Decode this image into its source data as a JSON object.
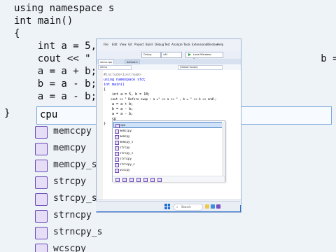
{
  "background_editor": {
    "code_lines": [
      "using namespace s",
      "int main()",
      "{",
      "    int a = 5, b",
      "    cout << \" Be                                    b = \" << b << endl;",
      "    a = a + b;",
      "    b = a - b;",
      "    a = a - b;",
      "    cp"
    ],
    "typed_text": "cpu",
    "suggestions": [
      "memccpy",
      "memcpy",
      "memcpy_s",
      "strcpy",
      "strcpy_s",
      "strncpy",
      "strncpy_s",
      "wcscpy"
    ],
    "highlight": "cpy",
    "closing_brace": "}"
  },
  "vs": {
    "menu": [
      "File",
      "Edit",
      "View",
      "Git",
      "Project",
      "Build",
      "Debug",
      "Test",
      "Analyze",
      "Tools",
      "Extensions",
      "Window",
      "Help"
    ],
    "config": "Debug",
    "platform": "x64",
    "run_label": "Local Windows Debugger",
    "tabs": [
      "demo.cpp",
      "default.h"
    ],
    "nav_scope": "demo",
    "nav_global": "(Global Scope)",
    "code": [
      {
        "text": "#include<iostream>",
        "kind": "pp"
      },
      {
        "text": "using namespace std;",
        "kind": "kw"
      },
      {
        "text": "int main()",
        "kind": "kw"
      },
      {
        "text": "{",
        "kind": "plain"
      },
      {
        "text": "    int a = 5, b = 10;",
        "kind": "plain"
      },
      {
        "text": "    cout << \" Before swap : a =\" << a << \" , b = \" << b << endl;",
        "kind": "plain"
      },
      {
        "text": "    a = a + b;",
        "kind": "plain"
      },
      {
        "text": "    b = a - b;",
        "kind": "plain"
      },
      {
        "text": "    a = a - b;",
        "kind": "plain"
      },
      {
        "text": "    cp",
        "kind": "plain"
      },
      {
        "text": "}",
        "kind": "plain"
      }
    ],
    "autocomplete": [
      "cpu",
      "memccpy",
      "memcpy",
      "memcpy_s",
      "strcpy",
      "strcpy_s",
      "strncpy",
      "strncpy_s",
      "wcscpy"
    ],
    "selected_index": 0,
    "status": [
      "0",
      "1"
    ]
  },
  "taskbar": {
    "search_label": "Search"
  },
  "colors": {
    "accent": "#2f6fc9",
    "editor_bg": "#eef3f8",
    "keyword": "#0000ff",
    "selection": "#cfe2f7"
  }
}
